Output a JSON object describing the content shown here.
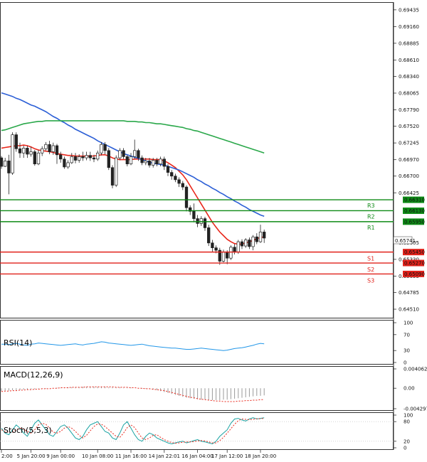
{
  "chart_data": {
    "type": "candlestick",
    "price_axis": {
      "ticks": [
        "0.69435",
        "0.69160",
        "0.68885",
        "0.68610",
        "0.68340",
        "0.68065",
        "0.67790",
        "0.67520",
        "0.67245",
        "0.66970",
        "0.66700",
        "0.66425",
        "0.65605",
        "0.65330",
        "0.65055",
        "0.64785",
        "0.64510"
      ],
      "range": [
        0.6437,
        0.6955
      ]
    },
    "time_axis": {
      "labels": [
        "2:00",
        "5 Jan 20:00",
        "9 Jan 00:00",
        "10 Jan 08:00",
        "11 Jan 16:00",
        "14 Jan 22:01",
        "16 Jan 04:00",
        "17 Jan 12:00",
        "18 Jan 20:00"
      ],
      "bar_index": [
        0,
        8,
        16,
        26,
        35,
        44,
        53,
        61,
        70
      ]
    },
    "current_price": "0.65741",
    "levels": [
      {
        "name": "R3",
        "value": 0.6631,
        "label": "0.66310",
        "color": "#0e8a16"
      },
      {
        "name": "R2",
        "value": 0.6613,
        "label": "0.66130",
        "color": "#0e8a16"
      },
      {
        "name": "R1",
        "value": 0.6595,
        "label": "0.65950",
        "color": "#0e8a16"
      },
      {
        "name": "S1",
        "value": 0.6545,
        "label": "0.65450",
        "color": "#e0211a"
      },
      {
        "name": "S2",
        "value": 0.6527,
        "label": "0.65270",
        "color": "#e0211a"
      },
      {
        "name": "S3",
        "value": 0.6509,
        "label": "0.65090",
        "color": "#e0211a"
      }
    ],
    "candles": [
      [
        0.67,
        0.6686,
        0.6703,
        0.6682
      ],
      [
        0.6686,
        0.6695,
        0.67,
        0.6685
      ],
      [
        0.6695,
        0.6675,
        0.6705,
        0.664
      ],
      [
        0.6675,
        0.6738,
        0.6742,
        0.6672
      ],
      [
        0.6738,
        0.6715,
        0.6742,
        0.671
      ],
      [
        0.6715,
        0.6708,
        0.6725,
        0.67
      ],
      [
        0.6708,
        0.6716,
        0.672,
        0.67
      ],
      [
        0.6716,
        0.6706,
        0.672,
        0.67
      ],
      [
        0.6706,
        0.671,
        0.6718,
        0.6702
      ],
      [
        0.671,
        0.669,
        0.6713,
        0.6687
      ],
      [
        0.669,
        0.6708,
        0.6713,
        0.6688
      ],
      [
        0.6708,
        0.6715,
        0.6719,
        0.6703
      ],
      [
        0.6715,
        0.6722,
        0.6726,
        0.6712
      ],
      [
        0.6722,
        0.671,
        0.6728,
        0.6706
      ],
      [
        0.671,
        0.672,
        0.6725,
        0.6705
      ],
      [
        0.672,
        0.6705,
        0.6723,
        0.669
      ],
      [
        0.6705,
        0.6698,
        0.671,
        0.6692
      ],
      [
        0.6698,
        0.6685,
        0.6702,
        0.6682
      ],
      [
        0.6685,
        0.6692,
        0.6696,
        0.6682
      ],
      [
        0.6692,
        0.6702,
        0.6708,
        0.669
      ],
      [
        0.6702,
        0.6696,
        0.6708,
        0.6691
      ],
      [
        0.6696,
        0.6702,
        0.6706,
        0.6692
      ],
      [
        0.6702,
        0.67,
        0.671,
        0.6695
      ],
      [
        0.67,
        0.6704,
        0.671,
        0.6696
      ],
      [
        0.6704,
        0.67,
        0.671,
        0.6695
      ],
      [
        0.67,
        0.6698,
        0.6705,
        0.6693
      ],
      [
        0.6698,
        0.6708,
        0.6712,
        0.6695
      ],
      [
        0.6708,
        0.6722,
        0.6726,
        0.6704
      ],
      [
        0.6722,
        0.6712,
        0.6726,
        0.6706
      ],
      [
        0.6712,
        0.6684,
        0.6716,
        0.668
      ],
      [
        0.6684,
        0.6655,
        0.6688,
        0.665
      ],
      [
        0.6655,
        0.67,
        0.6704,
        0.6652
      ],
      [
        0.67,
        0.6712,
        0.6716,
        0.6696
      ],
      [
        0.6712,
        0.6702,
        0.6716,
        0.6698
      ],
      [
        0.6702,
        0.669,
        0.6705,
        0.6686
      ],
      [
        0.669,
        0.6702,
        0.6708,
        0.6688
      ],
      [
        0.6702,
        0.6712,
        0.673,
        0.6698
      ],
      [
        0.6712,
        0.67,
        0.6715,
        0.6695
      ],
      [
        0.67,
        0.6692,
        0.6704,
        0.6688
      ],
      [
        0.6692,
        0.6695,
        0.67,
        0.6688
      ],
      [
        0.6695,
        0.6688,
        0.67,
        0.6684
      ],
      [
        0.6688,
        0.6696,
        0.67,
        0.6684
      ],
      [
        0.6696,
        0.669,
        0.67,
        0.6686
      ],
      [
        0.669,
        0.6698,
        0.6702,
        0.6686
      ],
      [
        0.6698,
        0.6686,
        0.6702,
        0.668
      ],
      [
        0.6686,
        0.6676,
        0.669,
        0.667
      ],
      [
        0.6676,
        0.667,
        0.668,
        0.6664
      ],
      [
        0.667,
        0.6664,
        0.6674,
        0.666
      ],
      [
        0.6664,
        0.6658,
        0.6668,
        0.6652
      ],
      [
        0.6658,
        0.6652,
        0.6662,
        0.6647
      ],
      [
        0.6652,
        0.6618,
        0.6655,
        0.6612
      ],
      [
        0.6618,
        0.6612,
        0.6622,
        0.6606
      ],
      [
        0.6612,
        0.66,
        0.6625,
        0.6594
      ],
      [
        0.66,
        0.6592,
        0.6606,
        0.6586
      ],
      [
        0.6592,
        0.66,
        0.6604,
        0.6588
      ],
      [
        0.66,
        0.6585,
        0.6603,
        0.658
      ],
      [
        0.6585,
        0.656,
        0.659,
        0.6555
      ],
      [
        0.656,
        0.6552,
        0.6565,
        0.6545
      ],
      [
        0.6552,
        0.6548,
        0.6556,
        0.6543
      ],
      [
        0.6548,
        0.653,
        0.6552,
        0.6524
      ],
      [
        0.653,
        0.6545,
        0.6549,
        0.6528
      ],
      [
        0.6545,
        0.6535,
        0.6548,
        0.6525
      ],
      [
        0.6535,
        0.6553,
        0.6556,
        0.6532
      ],
      [
        0.6553,
        0.6545,
        0.6558,
        0.6541
      ],
      [
        0.6545,
        0.6562,
        0.6565,
        0.6542
      ],
      [
        0.6562,
        0.6555,
        0.6566,
        0.655
      ],
      [
        0.6555,
        0.6565,
        0.6568,
        0.6552
      ],
      [
        0.6565,
        0.6554,
        0.6569,
        0.655
      ],
      [
        0.6554,
        0.657,
        0.6573,
        0.6548
      ],
      [
        0.657,
        0.6562,
        0.6576,
        0.6558
      ],
      [
        0.6562,
        0.6578,
        0.659,
        0.656
      ],
      [
        0.6578,
        0.6568,
        0.6582,
        0.656
      ]
    ],
    "indicators": {
      "moving_averages": [
        {
          "color": "#e8281c",
          "values": [
            0.6716,
            0.6717,
            0.6718,
            0.6719,
            0.672,
            0.672,
            0.6721,
            0.672,
            0.6718,
            0.6715,
            0.6713,
            0.6712,
            0.6711,
            0.671,
            0.6709,
            0.6707,
            0.6706,
            0.6705,
            0.6704,
            0.6704,
            0.6703,
            0.6703,
            0.6703,
            0.6703,
            0.6703,
            0.6703,
            0.6704,
            0.6705,
            0.6705,
            0.6703,
            0.67,
            0.6698,
            0.6697,
            0.6697,
            0.6697,
            0.6697,
            0.6698,
            0.6698,
            0.6698,
            0.6698,
            0.6698,
            0.6697,
            0.6697,
            0.6697,
            0.6695,
            0.6692,
            0.6688,
            0.6684,
            0.6678,
            0.6672,
            0.6664,
            0.6654,
            0.6644,
            0.6634,
            0.6624,
            0.6614,
            0.6604,
            0.6594,
            0.6586,
            0.6578,
            0.6572,
            0.6566,
            0.6562,
            0.6559,
            0.6558,
            0.6558,
            0.656,
            0.6562,
            0.6564,
            0.6567,
            0.6569,
            0.657
          ]
        },
        {
          "color": "#2c5fd6",
          "values": [
            0.6807,
            0.6805,
            0.6803,
            0.6801,
            0.6798,
            0.6796,
            0.6793,
            0.679,
            0.6787,
            0.6785,
            0.6782,
            0.6779,
            0.6776,
            0.6772,
            0.6768,
            0.6765,
            0.6761,
            0.6758,
            0.6754,
            0.6751,
            0.6747,
            0.6744,
            0.6741,
            0.6738,
            0.6735,
            0.6732,
            0.6728,
            0.6725,
            0.6722,
            0.6719,
            0.6716,
            0.6713,
            0.671,
            0.6707,
            0.6705,
            0.6703,
            0.6701,
            0.6699,
            0.6697,
            0.6695,
            0.6693,
            0.6691,
            0.669,
            0.6689,
            0.6688,
            0.6686,
            0.6684,
            0.6682,
            0.668,
            0.6677,
            0.6674,
            0.6671,
            0.6668,
            0.6664,
            0.6661,
            0.6657,
            0.6654,
            0.665,
            0.6647,
            0.6643,
            0.664,
            0.6636,
            0.6633,
            0.6629,
            0.6626,
            0.6622,
            0.6619,
            0.6615,
            0.6612,
            0.6609,
            0.6606,
            0.6604
          ]
        },
        {
          "color": "#2aa84a",
          "values": [
            0.6745,
            0.6746,
            0.6748,
            0.675,
            0.6752,
            0.6754,
            0.6756,
            0.6757,
            0.6758,
            0.6759,
            0.676,
            0.676,
            0.6761,
            0.6761,
            0.6761,
            0.6761,
            0.6761,
            0.6761,
            0.6761,
            0.6761,
            0.6761,
            0.6761,
            0.6761,
            0.6761,
            0.6761,
            0.6761,
            0.6761,
            0.6761,
            0.6761,
            0.6761,
            0.6761,
            0.6761,
            0.6761,
            0.6761,
            0.676,
            0.676,
            0.676,
            0.6759,
            0.6759,
            0.6758,
            0.6758,
            0.6757,
            0.6756,
            0.6756,
            0.6755,
            0.6754,
            0.6753,
            0.6752,
            0.6751,
            0.675,
            0.6748,
            0.6747,
            0.6745,
            0.6744,
            0.6742,
            0.674,
            0.6738,
            0.6736,
            0.6734,
            0.6732,
            0.673,
            0.6728,
            0.6726,
            0.6724,
            0.6722,
            0.672,
            0.6718,
            0.6716,
            0.6714,
            0.6712,
            0.671,
            0.6708
          ]
        }
      ],
      "rsi": {
        "title": "RSI(14)",
        "ticks": [
          "100",
          "70",
          "30",
          "0"
        ],
        "values": [
          46,
          46,
          45,
          47,
          48,
          46,
          44,
          43,
          46,
          47,
          49,
          48,
          47,
          46,
          45,
          44,
          43,
          44,
          45,
          46,
          47,
          45,
          44,
          46,
          47,
          48,
          50,
          52,
          51,
          49,
          48,
          47,
          46,
          45,
          44,
          43,
          44,
          45,
          46,
          44,
          42,
          41,
          40,
          39,
          38,
          37,
          36,
          36,
          35,
          34,
          33,
          33,
          34,
          35,
          36,
          35,
          34,
          33,
          32,
          31,
          30,
          31,
          33,
          35,
          36,
          37,
          39,
          41,
          43,
          46,
          48,
          47
        ]
      },
      "macd": {
        "title": "MACD(12,26,9)",
        "ticks": [
          "0.004062",
          "0.00",
          "-0.004297"
        ],
        "histogram": [
          -0.0006,
          -0.0005,
          -0.0005,
          -0.0004,
          -0.0004,
          -0.0004,
          -0.0003,
          -0.0003,
          -0.0002,
          -0.0002,
          -0.0001,
          -0.0001,
          -0.0001,
          0.0,
          0.0,
          0.0001,
          0.0001,
          0.0001,
          0.0002,
          0.0002,
          0.0002,
          0.0002,
          0.0003,
          0.0003,
          0.0003,
          0.0003,
          0.0003,
          0.0003,
          0.0003,
          0.0002,
          0.0002,
          0.0002,
          0.0002,
          0.0001,
          0.0001,
          0.0001,
          0.0,
          0.0,
          -0.0001,
          -0.0001,
          -0.0002,
          -0.0003,
          -0.0004,
          -0.0006,
          -0.0008,
          -0.001,
          -0.0012,
          -0.0014,
          -0.0016,
          -0.0018,
          -0.002,
          -0.0021,
          -0.0022,
          -0.0023,
          -0.0024,
          -0.0024,
          -0.0025,
          -0.0025,
          -0.0025,
          -0.0025,
          -0.0024,
          -0.0024,
          -0.0023,
          -0.0022,
          -0.0021,
          -0.002,
          -0.0019,
          -0.0018,
          -0.0017,
          -0.0016,
          -0.0016,
          -0.0015
        ],
        "signal": [
          -0.0007,
          -0.0006,
          -0.0006,
          -0.0005,
          -0.0005,
          -0.0004,
          -0.0004,
          -0.0003,
          -0.0003,
          -0.0002,
          -0.0002,
          -0.0001,
          -0.0001,
          -0.0001,
          0.0,
          0.0,
          0.0001,
          0.0001,
          0.0001,
          0.0002,
          0.0002,
          0.0002,
          0.0002,
          0.0003,
          0.0003,
          0.0003,
          0.0003,
          0.0003,
          0.0003,
          0.0003,
          0.0003,
          0.0002,
          0.0002,
          0.0002,
          0.0002,
          0.0001,
          0.0001,
          0.0,
          0.0,
          -0.0001,
          -0.0001,
          -0.0002,
          -0.0003,
          -0.0004,
          -0.0005,
          -0.0007,
          -0.0009,
          -0.0011,
          -0.0013,
          -0.0015,
          -0.0017,
          -0.0019,
          -0.002,
          -0.0022,
          -0.0023,
          -0.0024,
          -0.0025,
          -0.0026,
          -0.0027,
          -0.0027,
          -0.0028,
          -0.0028,
          -0.0028,
          -0.0028,
          -0.0027,
          -0.0027,
          -0.0026,
          -0.0026,
          -0.0025,
          -0.0025,
          -0.0024,
          -0.0024
        ]
      },
      "stoch": {
        "title": "Stoch(5,5,3)",
        "ticks": [
          "100",
          "80",
          "20",
          "0"
        ],
        "k": [
          60,
          45,
          40,
          55,
          70,
          60,
          45,
          35,
          55,
          75,
          85,
          70,
          55,
          40,
          35,
          50,
          65,
          70,
          60,
          45,
          30,
          25,
          35,
          55,
          70,
          75,
          80,
          65,
          50,
          45,
          30,
          25,
          45,
          70,
          80,
          60,
          40,
          25,
          20,
          35,
          45,
          40,
          30,
          25,
          20,
          15,
          12,
          15,
          18,
          20,
          15,
          18,
          22,
          25,
          20,
          18,
          15,
          12,
          20,
          35,
          45,
          55,
          75,
          88,
          90,
          85,
          82,
          88,
          92,
          88,
          90,
          92
        ],
        "d": [
          55,
          50,
          47,
          48,
          55,
          60,
          58,
          50,
          45,
          55,
          70,
          75,
          72,
          60,
          48,
          45,
          50,
          60,
          65,
          60,
          50,
          38,
          30,
          38,
          52,
          65,
          73,
          72,
          65,
          55,
          45,
          35,
          32,
          45,
          62,
          70,
          62,
          45,
          30,
          25,
          30,
          38,
          40,
          32,
          25,
          20,
          16,
          14,
          15,
          17,
          18,
          18,
          19,
          21,
          22,
          21,
          18,
          15,
          15,
          22,
          32,
          45,
          58,
          72,
          83,
          88,
          87,
          86,
          87,
          89,
          89,
          90
        ]
      }
    }
  }
}
